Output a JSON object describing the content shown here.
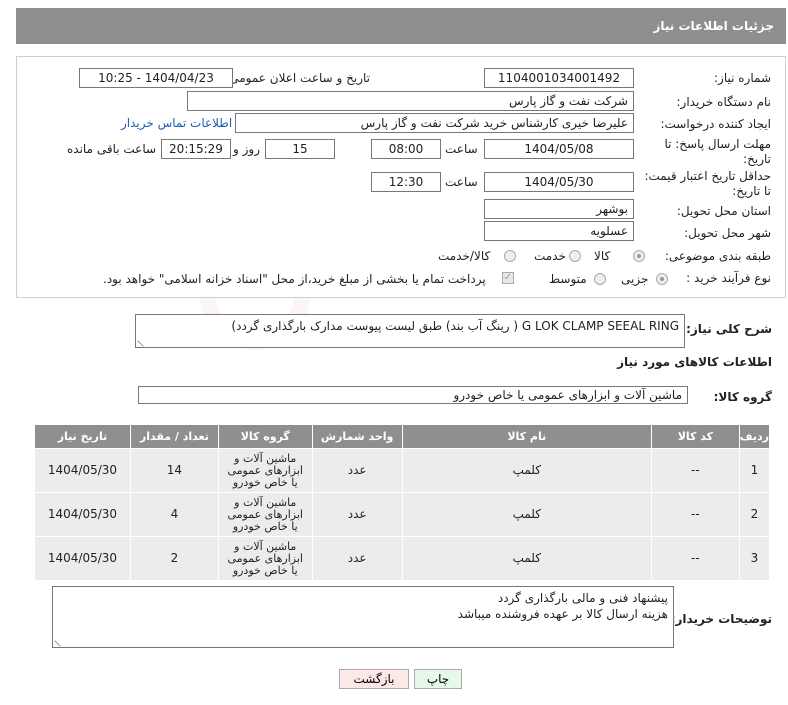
{
  "header": {
    "title": "جزئیات اطلاعات نیاز"
  },
  "form": {
    "need_number_label": "شماره نیاز:",
    "need_number": "1104001034001492",
    "announce_label": "تاریخ و ساعت اعلان عمومی:",
    "announce_value": "1404/04/23 - 10:25",
    "buyer_org_label": "نام دستگاه خریدار:",
    "buyer_org": "شرکت نفت و گاز پارس",
    "creator_label": "ایجاد کننده درخواست:",
    "creator": "علیرضا  خیری کارشناس خرید  شرکت نفت و گاز پارس",
    "contact_link": "اطلاعات تماس خریدار",
    "deadline_label_line1": "مهلت ارسال پاسخ: تا",
    "deadline_label_line2": "تاریخ:",
    "deadline_date": "1404/05/08",
    "time_label": "ساعت",
    "deadline_time": "08:00",
    "days_count": "15",
    "days_label": "روز و",
    "remaining_time": "20:15:29",
    "remaining_label": "ساعت باقی مانده",
    "price_validity_label_line1": "حداقل تاریخ اعتبار قیمت:",
    "price_validity_label_line2": "تا تاریخ:",
    "price_validity_date": "1404/05/30",
    "price_validity_time": "12:30",
    "province_label": "استان محل تحویل:",
    "province": "بوشهر",
    "city_label": "شهر محل تحویل:",
    "city": "عسلویه",
    "category_label": "طبقه بندی موضوعی:",
    "category_options": [
      "کالا",
      "خدمت",
      "کالا/خدمت"
    ],
    "category_selected": "کالا",
    "process_label": "نوع فرآیند خرید :",
    "process_options": [
      "جزیی",
      "متوسط"
    ],
    "process_selected": "جزیی",
    "payment_note": "پرداخت تمام یا بخشی از مبلغ خرید،از محل \"اسناد خزانه اسلامی\" خواهد بود."
  },
  "description": {
    "label": "شرح کلی نیاز:",
    "text": "G LOK CLAMP SEEAL RING ( رینگ آب بند) طبق لیست پیوست مدارک بارگذاری گردد)"
  },
  "goods": {
    "section_title": "اطلاعات کالاهای مورد نیاز",
    "group_label": "گروه کالا:",
    "group_value": "ماشین آلات و ابزارهای عمومی یا خاص خودرو"
  },
  "table": {
    "headers": [
      "ردیف",
      "کد کالا",
      "نام کالا",
      "واحد شمارش",
      "گروه کالا",
      "تعداد / مقدار",
      "تاریخ نیاز"
    ],
    "rows": [
      {
        "row": "1",
        "code": "--",
        "name": "کلمپ",
        "unit": "عدد",
        "group": "ماشین آلات و ابزارهای عمومی یا خاص خودرو",
        "qty": "14",
        "date": "1404/05/30"
      },
      {
        "row": "2",
        "code": "--",
        "name": "کلمپ",
        "unit": "عدد",
        "group": "ماشین آلات و ابزارهای عمومی یا خاص خودرو",
        "qty": "4",
        "date": "1404/05/30"
      },
      {
        "row": "3",
        "code": "--",
        "name": "کلمپ",
        "unit": "عدد",
        "group": "ماشین آلات و ابزارهای عمومی یا خاص خودرو",
        "qty": "2",
        "date": "1404/05/30"
      }
    ]
  },
  "buyer_notes": {
    "label": "توضیحات خریدار:",
    "line1": "پیشنهاد فنی و مالی بارگذاری گردد",
    "line2": "هزینه ارسال کالا بر عهده فروشنده میباشد"
  },
  "buttons": {
    "print": "چاپ",
    "back": "بازگشت"
  },
  "watermark": {
    "text": "AriaTender.net"
  },
  "colors": {
    "header_bg": "#8f8f8f",
    "row_bg": "#ececec",
    "link": "#1c5fb0",
    "back_btn_bg": "#fde8e8",
    "print_btn_bg": "#e8f8e8"
  }
}
